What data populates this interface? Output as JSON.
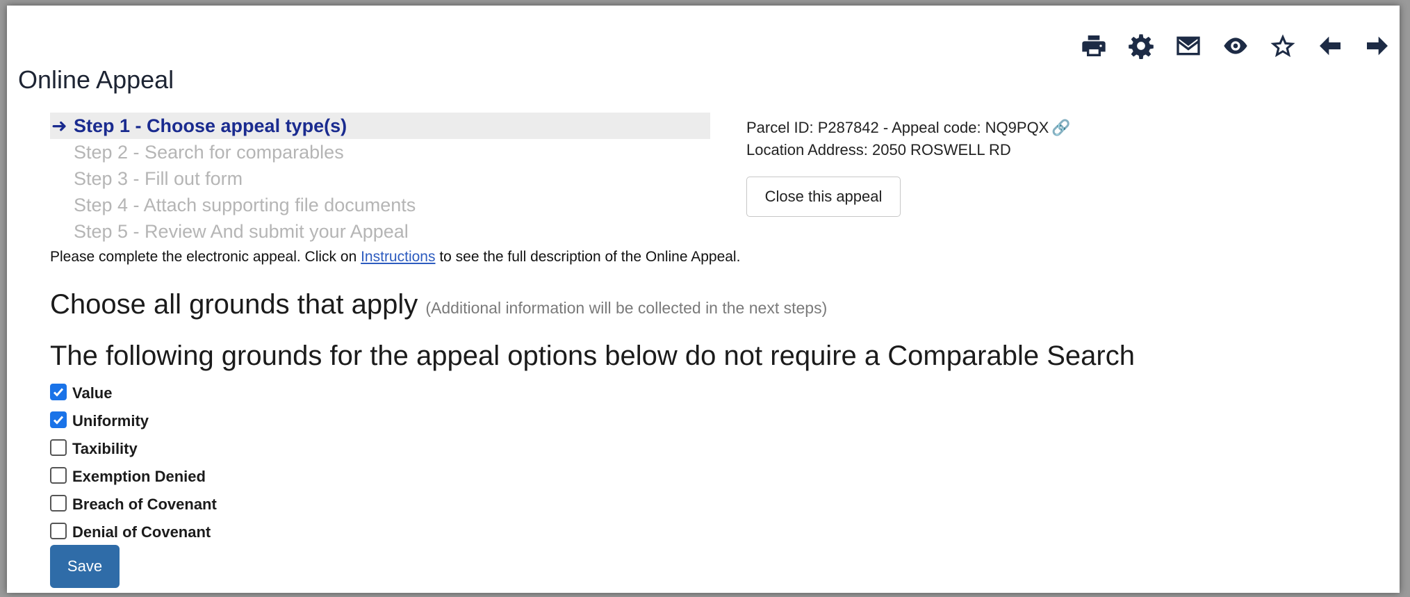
{
  "page": {
    "title": "Online Appeal"
  },
  "toolbar": {
    "icons": [
      "print-icon",
      "gear-icon",
      "mail-icon",
      "eye-icon",
      "star-icon",
      "arrow-left-icon",
      "arrow-right-icon"
    ]
  },
  "steps": {
    "items": [
      {
        "label": "Step 1 - Choose appeal type(s)",
        "active": true
      },
      {
        "label": "Step 2 - Search for comparables",
        "active": false
      },
      {
        "label": "Step 3 - Fill out form",
        "active": false
      },
      {
        "label": "Step 4 - Attach supporting file documents",
        "active": false
      },
      {
        "label": "Step 5 - Review And submit your Appeal",
        "active": false
      }
    ]
  },
  "parcel": {
    "line1": "Parcel ID: P287842 - Appeal code: NQ9PQX",
    "line2": "Location Address: 2050 ROSWELL RD",
    "close_label": "Close this appeal"
  },
  "instructions": {
    "before": "Please complete the electronic appeal. Click on ",
    "link": "Instructions",
    "after": " to see the full description of the Online Appeal."
  },
  "headings": {
    "choose": "Choose all grounds that apply",
    "choose_sub": "(Additional information will be collected in the next steps)",
    "following": "The following grounds for the appeal options below do not require a Comparable Search"
  },
  "grounds": [
    {
      "label": "Value",
      "checked": true
    },
    {
      "label": "Uniformity",
      "checked": true
    },
    {
      "label": "Taxibility",
      "checked": false
    },
    {
      "label": "Exemption Denied",
      "checked": false
    },
    {
      "label": "Breach of Covenant",
      "checked": false
    },
    {
      "label": "Denial of Covenant",
      "checked": false
    }
  ],
  "actions": {
    "save_label": "Save"
  },
  "colors": {
    "accent": "#2f6ca8",
    "active_step": "#1a2b8f",
    "checkbox_checked": "#1a73e8"
  }
}
